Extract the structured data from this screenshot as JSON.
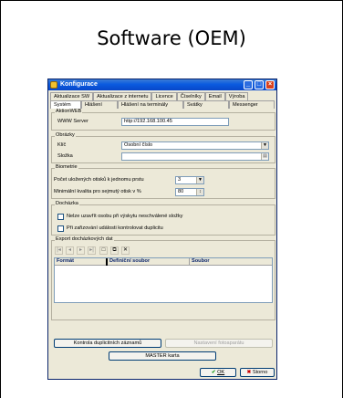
{
  "page": {
    "title": "Software (OEM)"
  },
  "window": {
    "title": "Konfigurace",
    "controls": {
      "minimize": "_",
      "maximize": "□",
      "close": "×"
    }
  },
  "tabs_top": [
    "Aktualizace SW",
    "Aktualizace z internetu",
    "Licence",
    "Číselníky",
    "Email",
    "Výroba"
  ],
  "tabs_bottom": [
    "Systém",
    "Hlášení",
    "Hlášení na terminály",
    "Svátky",
    "Messenger"
  ],
  "aktion_web": {
    "label": "AktionWEB",
    "server_label": "WWW Server",
    "server_value": "http://192.168.100.45"
  },
  "obrazky": {
    "label": "Obrázky",
    "klic_label": "Klíč",
    "klic_value": "Osobní číslo",
    "slozka_label": "Složka",
    "slozka_value": ""
  },
  "biometrie": {
    "label": "Biometrie",
    "pocet_label": "Počet uložených otisků k jednomu prstu",
    "pocet_value": "3",
    "kvalita_label": "Minimální kvalita pro sejmutý otisk v %",
    "kvalita_value": "80"
  },
  "dochazka": {
    "label": "Docházka",
    "option1": "Nelze uzavřít osobu při výskytu neschválené složky",
    "option2": "Při zařizování události kontrolovat duplicitu"
  },
  "export": {
    "label": "Export docházkových dat",
    "columns": [
      "Formát",
      "Definiční soubor",
      "Soubor"
    ]
  },
  "buttons": {
    "kontrola": "Kontrola duplicitních záznamů",
    "nastaveni": "Nastavení fotoaparátu",
    "master": "MASTER karta",
    "ok": "OK",
    "storno": "Storno"
  },
  "colors": {
    "titlebar": "#0a5ae0",
    "window_bg": "#ece9d8",
    "ok_check": "#1e9e1e",
    "storno_x": "#cc0000"
  },
  "icons": [
    "folder-icon",
    "check-icon",
    "cross-icon",
    "new-doc-icon",
    "copy-doc-icon"
  ]
}
